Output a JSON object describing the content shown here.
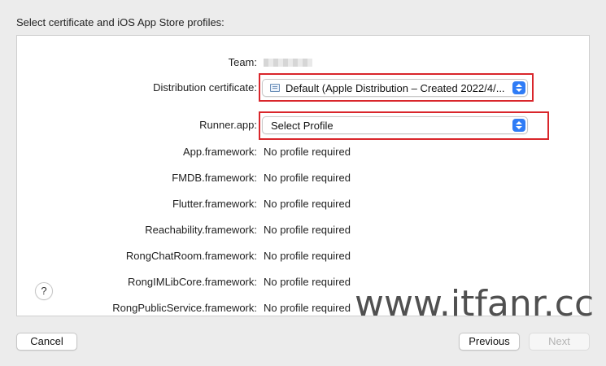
{
  "heading": "Select certificate and iOS App Store profiles:",
  "team": {
    "label": "Team:"
  },
  "distribution": {
    "label": "Distribution certificate:",
    "value": "Default (Apple Distribution – Created 2022/4/..."
  },
  "runner": {
    "label": "Runner.app:",
    "value": "Select Profile"
  },
  "frameworks": [
    {
      "label": "App.framework:",
      "value": "No profile required"
    },
    {
      "label": "FMDB.framework:",
      "value": "No profile required"
    },
    {
      "label": "Flutter.framework:",
      "value": "No profile required"
    },
    {
      "label": "Reachability.framework:",
      "value": "No profile required"
    },
    {
      "label": "RongChatRoom.framework:",
      "value": "No profile required"
    },
    {
      "label": "RongIMLibCore.framework:",
      "value": "No profile required"
    },
    {
      "label": "RongPublicService.framework:",
      "value": "No profile required"
    }
  ],
  "help": "?",
  "watermark": "www.itfanr.cc",
  "buttons": {
    "cancel": "Cancel",
    "previous": "Previous",
    "next": "Next"
  },
  "colors": {
    "accent": "#2f7cf6",
    "highlight": "#d9262b"
  }
}
